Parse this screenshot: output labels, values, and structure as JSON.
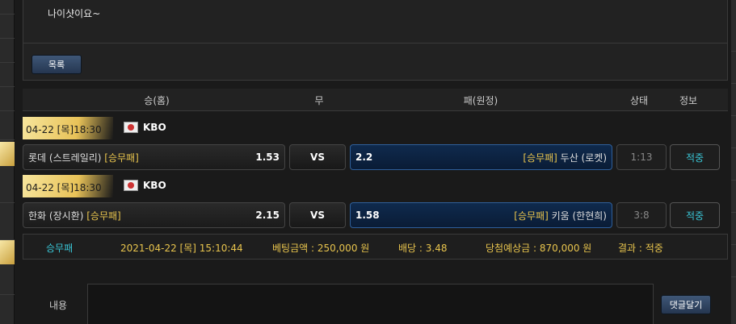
{
  "post": {
    "content": "나이샷이요~",
    "list_button": "목록"
  },
  "table_header": {
    "win_home": "승(홈)",
    "draw": "무",
    "lose_away": "패(원정)",
    "status": "상태",
    "info": "정보"
  },
  "games": [
    {
      "date": "04-22 [목]18:30",
      "league": "KBO",
      "home_team": "롯데 (스트레일리)",
      "home_pick": "[승무패]",
      "home_odd": "1.53",
      "vs": "VS",
      "away_odd": "2.2",
      "away_pick": "[승무패]",
      "away_team": "두산 (로켓)",
      "score": "1:13",
      "result": "적중"
    },
    {
      "date": "04-22 [목]18:30",
      "league": "KBO",
      "home_team": "한화 (장시환)",
      "home_pick": "[승무패]",
      "home_odd": "2.15",
      "vs": "VS",
      "away_odd": "1.58",
      "away_pick": "[승무패]",
      "away_team": "키움 (한현희)",
      "score": "3:8",
      "result": "적중"
    }
  ],
  "summary": {
    "type": "승무패",
    "datetime": "2021-04-22 [목] 15:10:44",
    "bet_amount": "베팅금액 : 250,000 원",
    "odds": "배당 : 3.48",
    "expected_win": "당첨예상금 : 870,000 원",
    "result": "결과 : 적중"
  },
  "comment": {
    "label": "내용",
    "submit_button": "댓글달기"
  },
  "colors": {
    "accent_gold": "#e8c44d",
    "hit_cyan": "#39c6d6",
    "away_blue": "#0f2a4d"
  }
}
